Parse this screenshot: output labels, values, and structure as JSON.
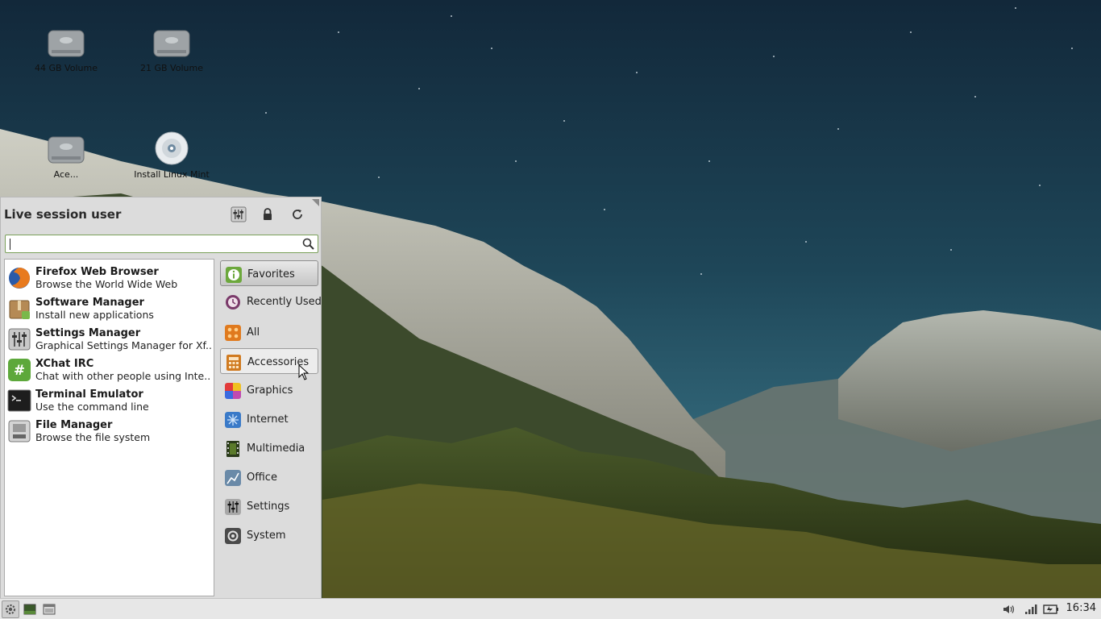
{
  "desktop": {
    "icons": [
      {
        "label": "44 GB Volume",
        "icon": "hard-drive-icon"
      },
      {
        "label": "21 GB Volume",
        "icon": "hard-drive-icon"
      },
      {
        "label": "Ace...",
        "icon": "hard-drive-icon"
      },
      {
        "label": "Install Linux Mint",
        "icon": "optical-disc-icon"
      }
    ]
  },
  "menu": {
    "user_name": "Live session user",
    "header_buttons": [
      {
        "icon": "settings-manager-icon"
      },
      {
        "icon": "lock-icon"
      },
      {
        "icon": "refresh-icon"
      }
    ],
    "search": {
      "value": "",
      "placeholder": ""
    },
    "apps": [
      {
        "name": "Firefox Web Browser",
        "desc": "Browse the World Wide Web",
        "icon": "firefox-icon",
        "color": "#e66a1e"
      },
      {
        "name": "Software Manager",
        "desc": "Install new applications",
        "icon": "package-icon",
        "color": "#b58a55"
      },
      {
        "name": "Settings Manager",
        "desc": "Graphical Settings Manager for Xf...",
        "icon": "sliders-icon",
        "color": "#8c8c8c"
      },
      {
        "name": "XChat IRC",
        "desc": "Chat with other people using Inte...",
        "icon": "hash-icon",
        "color": "#5da83b"
      },
      {
        "name": "Terminal Emulator",
        "desc": "Use the command line",
        "icon": "terminal-icon",
        "color": "#1d1d1d"
      },
      {
        "name": "File Manager",
        "desc": "Browse the file system",
        "icon": "drive-icon",
        "color": "#9a9a9a"
      }
    ],
    "categories": [
      {
        "label": "Favorites",
        "icon": "info-icon",
        "color": "#6ca83c",
        "state": "active"
      },
      {
        "label": "Recently Used",
        "icon": "history-icon",
        "color": "#7a3a6a",
        "state": ""
      },
      {
        "label": "All",
        "icon": "all-apps-icon",
        "color": "#e07a1e",
        "state": ""
      },
      {
        "label": "Accessories",
        "icon": "calculator-icon",
        "color": "#d07a20",
        "state": "hover"
      },
      {
        "label": "Graphics",
        "icon": "palette-icon",
        "color": "#c04ab0",
        "state": ""
      },
      {
        "label": "Internet",
        "icon": "globe-icon",
        "color": "#3a7ac8",
        "state": ""
      },
      {
        "label": "Multimedia",
        "icon": "film-icon",
        "color": "#5a7a2a",
        "state": ""
      },
      {
        "label": "Office",
        "icon": "chart-icon",
        "color": "#6a8aa8",
        "state": ""
      },
      {
        "label": "Settings",
        "icon": "sliders-icon",
        "color": "#8a8a8a",
        "state": ""
      },
      {
        "label": "System",
        "icon": "gear-system-icon",
        "color": "#4a4a4a",
        "state": ""
      }
    ]
  },
  "panel": {
    "left_buttons": [
      {
        "icon": "menu-gear-icon"
      },
      {
        "icon": "show-desktop-icon"
      },
      {
        "icon": "window-icon"
      }
    ],
    "tray": [
      {
        "icon": "volume-icon"
      },
      {
        "icon": "network-signal-icon"
      },
      {
        "icon": "battery-icon"
      }
    ],
    "clock": "16:34"
  }
}
